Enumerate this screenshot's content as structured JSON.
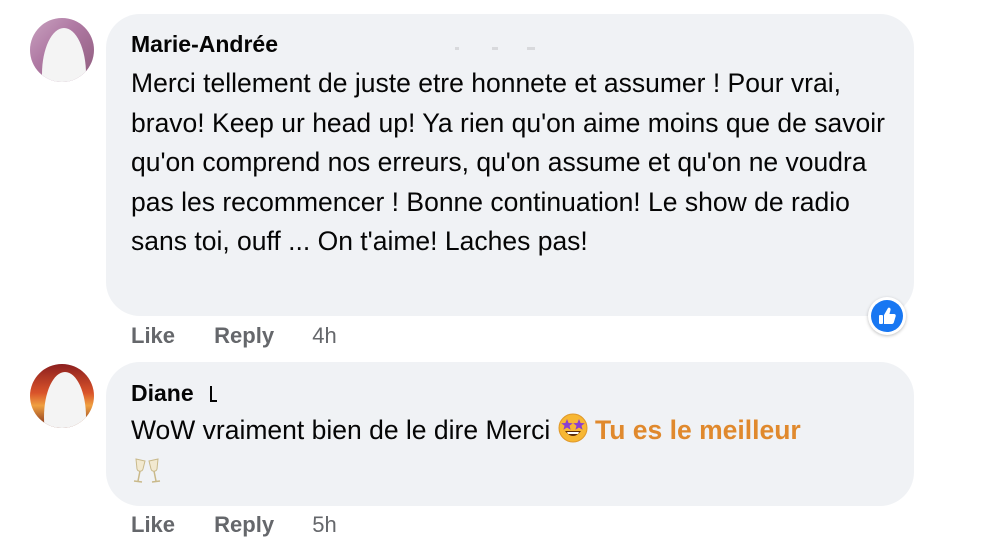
{
  "comments": [
    {
      "author": "Marie-Andrée",
      "text": "Merci tellement de juste etre honnete et assumer ! Pour vrai, bravo! Keep ur head up! Ya rien qu'on aime moins que de savoir qu'on comprend nos erreurs, qu'on assume et qu'on ne voudra pas les recommencer ! Bonne continuation! Le show de radio sans toi, ouff ... On t'aime! Laches pas!",
      "like_label": "Like",
      "reply_label": "Reply",
      "time": "4h",
      "reaction_icon": "thumbs-up-icon"
    },
    {
      "author": "Diane",
      "text": "WoW vraiment bien de le dire Merci",
      "emoji_1": "star-struck-emoji",
      "tag_text": "Tu es le meilleur",
      "emoji_2": "clinking-glasses-emoji",
      "like_label": "Like",
      "reply_label": "Reply",
      "time": "5h"
    }
  ],
  "colors": {
    "bubble": "#f0f2f5",
    "action_text": "#65676b",
    "tag": "#e0892d",
    "reaction": "#1877f2"
  }
}
